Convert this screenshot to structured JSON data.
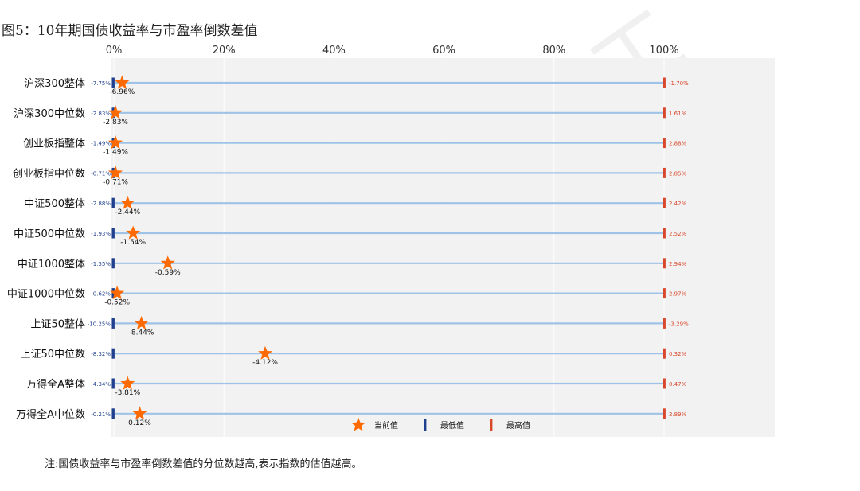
{
  "figure": {
    "title": "图5：10年期国债收益率与市盈率倒数差值",
    "note": "注:国债收益率与市盈率倒数差值的分位数越高,表示指数的估值越高。",
    "watermark": "天风金工"
  },
  "chart_data": {
    "type": "scatter",
    "title": "",
    "xlabel": "",
    "ylabel": "",
    "xlim": [
      0,
      100
    ],
    "x_tick_labels": [
      "0%",
      "20%",
      "40%",
      "60%",
      "80%",
      "100%"
    ],
    "x_ticks": [
      0,
      20,
      40,
      60,
      80,
      100
    ],
    "legend": {
      "placement": "bottom-center",
      "entries": [
        "当前值",
        "最低值",
        "最高值"
      ]
    },
    "colors": {
      "current": "#ff6a00",
      "min": "#1f3f8f",
      "max": "#d9472b",
      "track": "#9fc3e6",
      "panel": "#f2f2f2"
    },
    "categories": [
      "沪深300整体",
      "沪深300中位数",
      "创业板指整体",
      "创业板指中位数",
      "中证500整体",
      "中证500中位数",
      "中证1000整体",
      "中证1000中位数",
      "上证50整体",
      "上证50中位数",
      "万得全A整体",
      "万得全A中位数"
    ],
    "percentile": [
      1.5,
      0.3,
      0.3,
      0.3,
      2.5,
      3.5,
      9.8,
      0.6,
      5.0,
      27.5,
      2.5,
      4.7
    ],
    "current_labels": [
      "-6.96%",
      "-2.83%",
      "-1.49%",
      "-0.71%",
      "-2.44%",
      "-1.54%",
      "-0.59%",
      "-0.52%",
      "-8.44%",
      "-4.12%",
      "-3.81%",
      "0.12%"
    ],
    "min_labels": [
      "-7.75%",
      "-2.83%",
      "-1.49%",
      "-0.71%",
      "-2.88%",
      "-1.93%",
      "-1.55%",
      "-0.62%",
      "-10.25%",
      "-8.32%",
      "-4.34%",
      "-0.21%"
    ],
    "max_labels": [
      "-1.70%",
      "1.61%",
      "2.88%",
      "2.85%",
      "2.42%",
      "2.52%",
      "2.94%",
      "2.97%",
      "-3.29%",
      "0.32%",
      "0.47%",
      "2.89%"
    ]
  }
}
